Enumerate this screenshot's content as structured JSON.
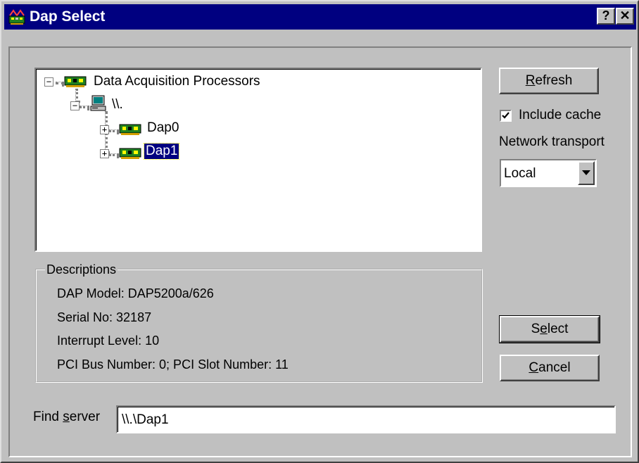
{
  "window": {
    "title": "Dap Select",
    "help_label": "?",
    "close_label": "✕"
  },
  "tree": {
    "root": {
      "label": "Data Acquisition Processors",
      "expander": "−",
      "icon": "dap-card-icon"
    },
    "server": {
      "label": "\\\\.",
      "expander": "−",
      "icon": "computer-icon"
    },
    "children": [
      {
        "label": "Dap0",
        "expander": "+",
        "icon": "dap-card-icon",
        "selected": false
      },
      {
        "label": "Dap1",
        "expander": "+",
        "icon": "dap-card-icon",
        "selected": true
      }
    ]
  },
  "descriptions": {
    "legend": "Descriptions",
    "lines": [
      "DAP Model: DAP5200a/626",
      "Serial No: 32187",
      "Interrupt Level: 10",
      "PCI Bus Number: 0; PCI Slot Number: 11"
    ]
  },
  "buttons": {
    "refresh": {
      "pre": "",
      "mn": "R",
      "post": "efresh"
    },
    "select": {
      "pre": "S",
      "mn": "e",
      "post": "lect"
    },
    "cancel": {
      "pre": "",
      "mn": "C",
      "post": "ancel"
    }
  },
  "include_cache": {
    "label": "Include cache",
    "checked": true
  },
  "network_transport": {
    "label": "Network transport",
    "value": "Local"
  },
  "find_server": {
    "label_pre": "Find ",
    "label_mn": "s",
    "label_post": "erver",
    "value": "\\\\.\\Dap1"
  },
  "colors": {
    "titlebar": "#000080",
    "face": "#c0c0c0",
    "selection": "#000080"
  }
}
